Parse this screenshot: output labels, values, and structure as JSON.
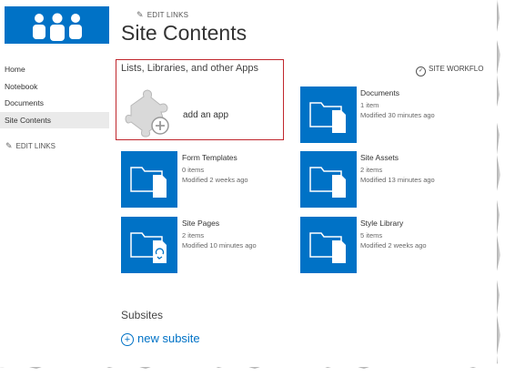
{
  "header": {
    "edit_links": "EDIT LINKS",
    "title": "Site Contents"
  },
  "nav": {
    "items": [
      {
        "label": "Home"
      },
      {
        "label": "Notebook"
      },
      {
        "label": "Documents"
      },
      {
        "label": "Site Contents",
        "selected": true
      }
    ],
    "edit_links": "EDIT LINKS"
  },
  "apps_section": {
    "heading": "Lists, Libraries, and other Apps",
    "add_app_label": "add an app",
    "workflows_label": "SITE WORKFLO"
  },
  "libraries": [
    {
      "name": "Documents",
      "count": "1 item",
      "modified": "Modified 30 minutes ago",
      "icon": "folder-icon"
    },
    {
      "name": "Form Templates",
      "count": "0 items",
      "modified": "Modified 2 weeks ago",
      "icon": "folder-icon"
    },
    {
      "name": "Site Assets",
      "count": "2 items",
      "modified": "Modified 13 minutes ago",
      "icon": "folder-icon"
    },
    {
      "name": "Site Pages",
      "count": "2 items",
      "modified": "Modified 10 minutes ago",
      "icon": "folder-recycle-icon"
    },
    {
      "name": "Style Library",
      "count": "5 items",
      "modified": "Modified 2 weeks ago",
      "icon": "folder-icon"
    }
  ],
  "subsites": {
    "heading": "Subsites",
    "new_subsite": "new subsite"
  },
  "colors": {
    "accent": "#0072c6",
    "highlight_box": "#c0262d",
    "selected_nav": "#eaeaea"
  }
}
